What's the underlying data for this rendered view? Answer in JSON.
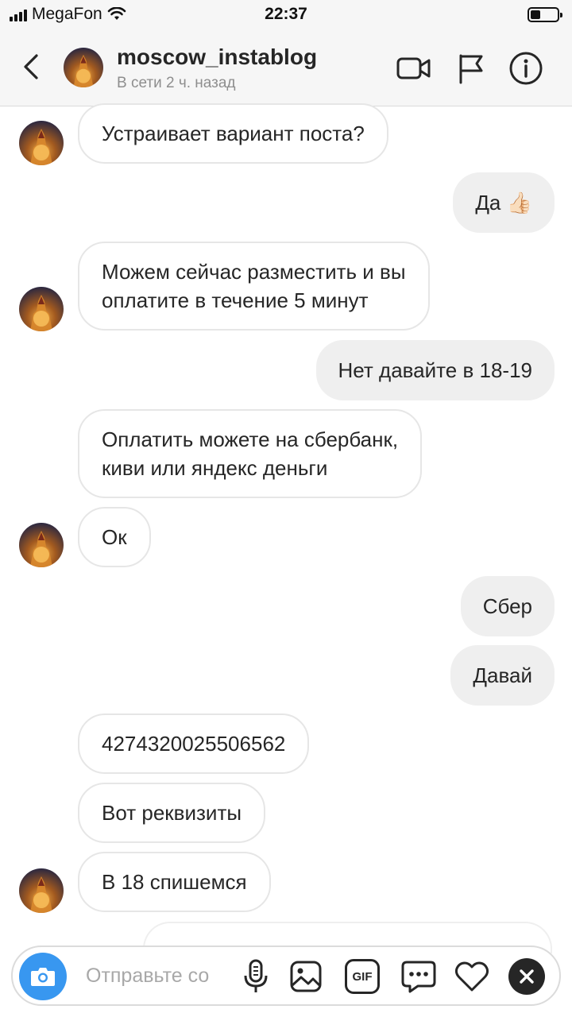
{
  "status_bar": {
    "carrier": "MegaFon",
    "time": "22:37"
  },
  "header": {
    "username": "moscow_instablog",
    "status": "В сети 2 ч. назад"
  },
  "messages": [
    {
      "side": "incoming",
      "text": "Устраивает вариант поста?"
    },
    {
      "side": "outgoing",
      "text": "Да 👍🏻"
    },
    {
      "side": "incoming",
      "text": "Можем сейчас разместить и вы\nоплатите в течение 5 минут"
    },
    {
      "side": "outgoing",
      "text": "Нет давайте в 18-19"
    },
    {
      "side": "incoming",
      "text": "Оплатить можете на сбербанк,\nкиви или яндекс деньги"
    },
    {
      "side": "incoming",
      "text": "Ок"
    },
    {
      "side": "outgoing",
      "text": "Сбер"
    },
    {
      "side": "outgoing",
      "text": "Давай"
    },
    {
      "side": "incoming",
      "text": "4274320025506562"
    },
    {
      "side": "incoming",
      "text": "Вот реквизиты"
    },
    {
      "side": "incoming",
      "text": "В 18 спишемся"
    }
  ],
  "composer": {
    "placeholder": "Отправьте со",
    "gif_label": "GIF"
  },
  "colors": {
    "accent": "#3897f0",
    "outgoing_bubble": "#efefef",
    "incoming_border": "#e6e6e6"
  }
}
